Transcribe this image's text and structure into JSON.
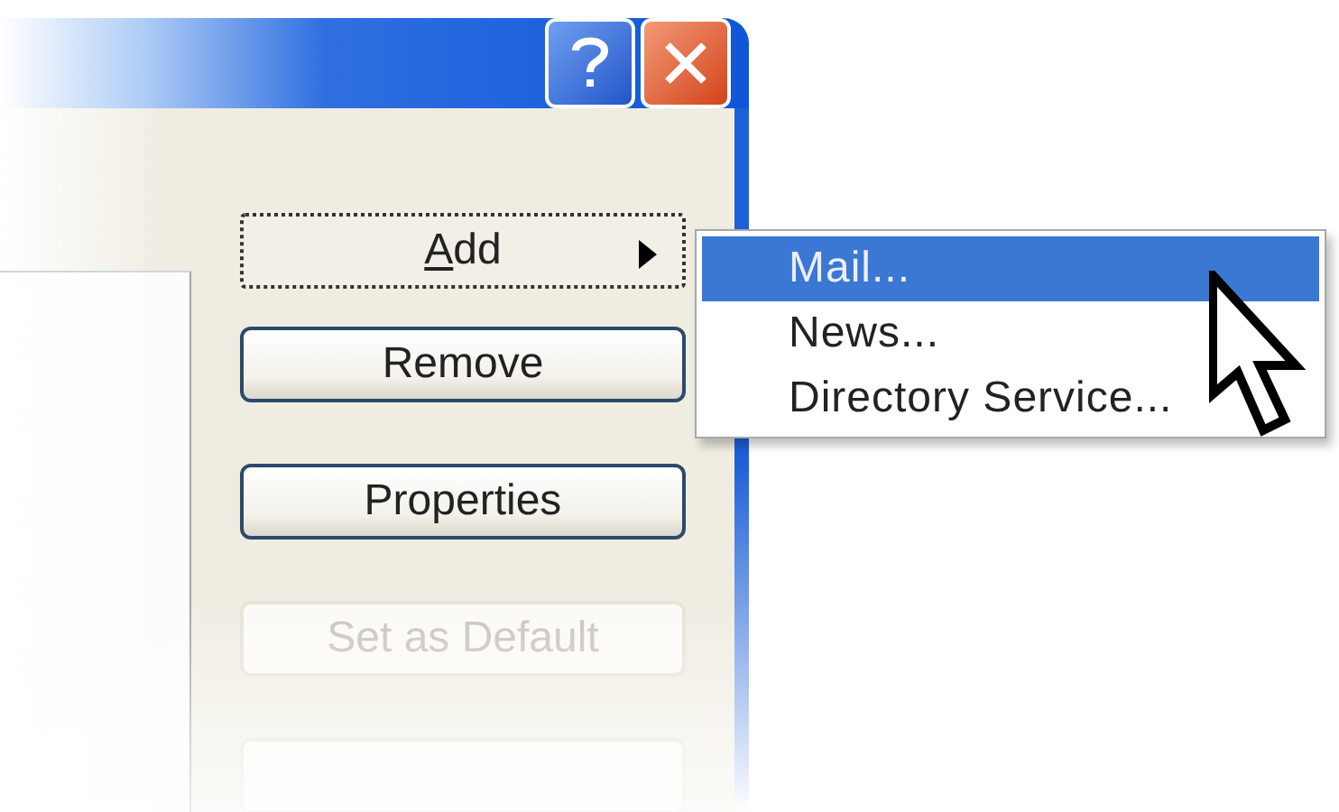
{
  "buttons": [
    {
      "label": "Add",
      "mnemonic_underlined": true,
      "focused": true,
      "has_submenu": true,
      "disabled": false
    },
    {
      "label": "Remove",
      "focused": false,
      "has_submenu": false,
      "disabled": false
    },
    {
      "label": "Properties",
      "focused": false,
      "has_submenu": false,
      "disabled": false
    },
    {
      "label": "Set as Default",
      "focused": false,
      "has_submenu": false,
      "disabled": true
    },
    {
      "focused": false,
      "has_submenu": false,
      "disabled": true
    }
  ],
  "submenu": {
    "items": [
      {
        "label": "Mail...",
        "selected": true
      },
      {
        "label": "News...",
        "selected": false
      },
      {
        "label": "Directory Service...",
        "selected": false
      }
    ]
  }
}
